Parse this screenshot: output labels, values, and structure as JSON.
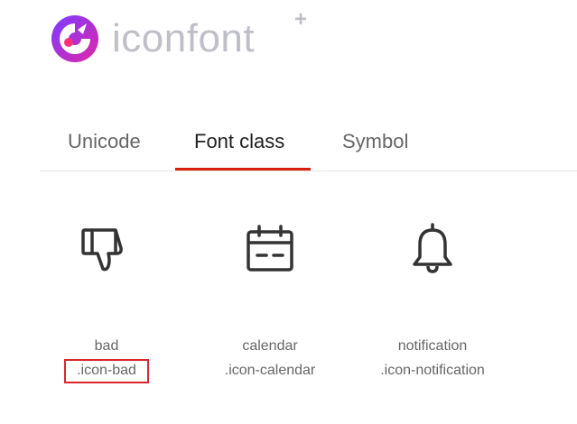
{
  "brand": {
    "name": "iconfont",
    "plus": "+"
  },
  "tabs": [
    {
      "label": "Unicode"
    },
    {
      "label": "Font class"
    },
    {
      "label": "Symbol"
    }
  ],
  "active_tab": "Font class",
  "icons": [
    {
      "name": "bad",
      "class": ".icon-bad",
      "icon": "thumbs-down-icon"
    },
    {
      "name": "calendar",
      "class": ".icon-calendar",
      "icon": "calendar-icon"
    },
    {
      "name": "notification",
      "class": ".icon-notification",
      "icon": "bell-icon"
    }
  ],
  "colors": {
    "accent": "#d81e06",
    "highlight_box": "#d9262f",
    "logo_gradient_start": "#7a3cff",
    "logo_gradient_end": "#e026a8",
    "text_muted": "#666666"
  }
}
